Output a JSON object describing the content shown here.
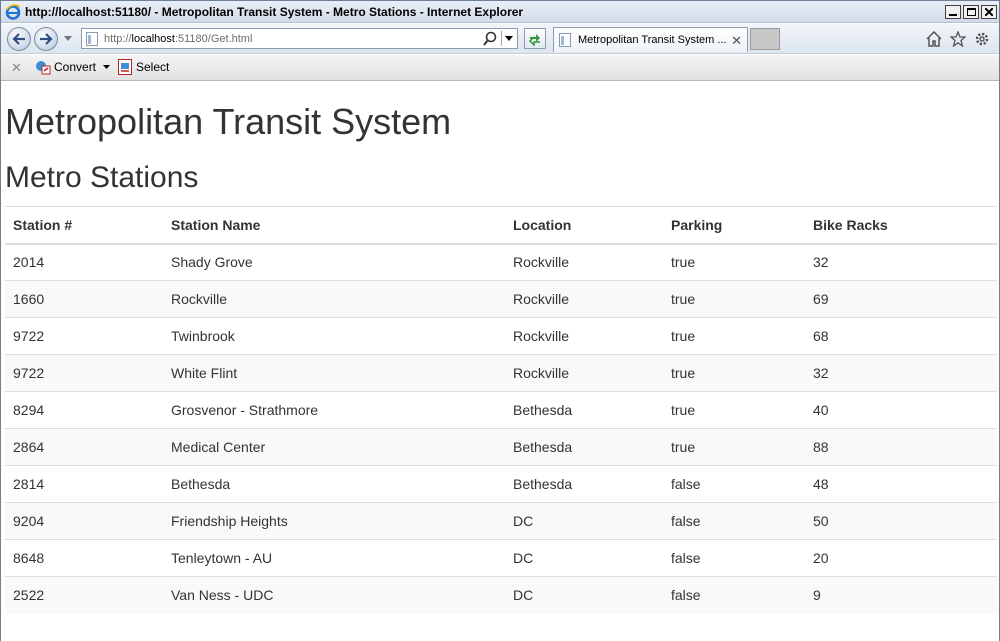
{
  "window": {
    "title": "http://localhost:51180/ - Metropolitan Transit System - Metro Stations - Internet Explorer"
  },
  "navbar": {
    "url_prefix": "http://",
    "url_host": "localhost",
    "url_rest": ":51180/Get.html",
    "tab_label": "Metropolitan Transit System ..."
  },
  "commandbar": {
    "convert_label": "Convert",
    "select_label": "Select"
  },
  "page": {
    "title": "Metropolitan Transit System",
    "subtitle": "Metro Stations"
  },
  "table": {
    "headers": [
      "Station #",
      "Station Name",
      "Location",
      "Parking",
      "Bike Racks"
    ],
    "rows": [
      [
        "2014",
        "Shady Grove",
        "Rockville",
        "true",
        "32"
      ],
      [
        "1660",
        "Rockville",
        "Rockville",
        "true",
        "69"
      ],
      [
        "9722",
        "Twinbrook",
        "Rockville",
        "true",
        "68"
      ],
      [
        "9722",
        "White Flint",
        "Rockville",
        "true",
        "32"
      ],
      [
        "8294",
        "Grosvenor - Strathmore",
        "Bethesda",
        "true",
        "40"
      ],
      [
        "2864",
        "Medical Center",
        "Bethesda",
        "true",
        "88"
      ],
      [
        "2814",
        "Bethesda",
        "Bethesda",
        "false",
        "48"
      ],
      [
        "9204",
        "Friendship Heights",
        "DC",
        "false",
        "50"
      ],
      [
        "8648",
        "Tenleytown - AU",
        "DC",
        "false",
        "20"
      ],
      [
        "2522",
        "Van Ness - UDC",
        "DC",
        "false",
        "9"
      ]
    ]
  },
  "icons": {
    "browser": "ie-logo-icon",
    "back": "back-arrow-icon",
    "forward": "forward-arrow-icon",
    "home": "home-icon",
    "favorites": "star-icon",
    "tools": "gear-icon"
  },
  "colors": {
    "title_text": "#333333",
    "row_stripe": "#f9f9f9",
    "table_border": "#dddddd"
  }
}
